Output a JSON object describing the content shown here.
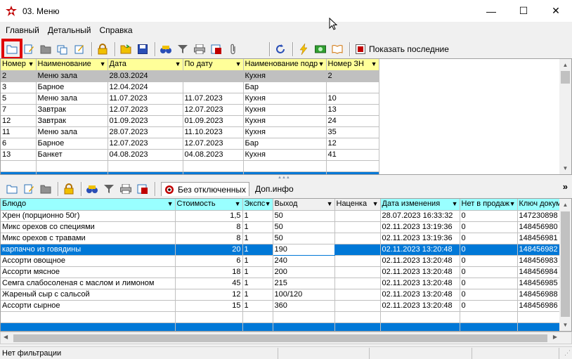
{
  "window": {
    "title": "03. Меню",
    "controls": {
      "minimize": "—",
      "maximize": "☐",
      "close": "✕"
    }
  },
  "menu": [
    "Главный",
    "Детальный",
    "Справка"
  ],
  "toolbar_top": {
    "show_last_label": "Показать последние"
  },
  "top_grid": {
    "columns": [
      "Номер",
      "Наименование",
      "Дата",
      "По дату",
      "Наименование подр",
      "Номер ЗН"
    ],
    "rows": [
      [
        "2",
        "Меню зала",
        "28.03.2024",
        "",
        "Кухня",
        "2"
      ],
      [
        "3",
        "Барное",
        "12.04.2024",
        "",
        "Бар",
        ""
      ],
      [
        "5",
        "Меню зала",
        "11.07.2023",
        "11.07.2023",
        "Кухня",
        "10"
      ],
      [
        "7",
        "Завтрак",
        "12.07.2023",
        "12.07.2023",
        "Кухня",
        "13"
      ],
      [
        "12",
        "Завтрак",
        "01.09.2023",
        "01.09.2023",
        "Кухня",
        "24"
      ],
      [
        "11",
        "Меню зала",
        "28.07.2023",
        "11.10.2023",
        "Кухня",
        "35"
      ],
      [
        "6",
        "Барное",
        "12.07.2023",
        "12.07.2023",
        "Бар",
        "12"
      ],
      [
        "13",
        "Банкет",
        "04.08.2023",
        "04.08.2023",
        "Кухня",
        "41"
      ]
    ]
  },
  "bottom_toolbar": {
    "tab_active": "Без отключенных",
    "tab_inactive": "Доп.инфо",
    "overflow": "»"
  },
  "bottom_grid": {
    "columns": [
      "Блюдо",
      "Стоимость",
      "Экспс",
      "Выход",
      "Наценка",
      "Дата изменения",
      "Нет в продаж",
      "Ключ докум"
    ],
    "rows": [
      [
        "Хрен (порционно 50г)",
        "1,5",
        "1",
        "50",
        "",
        "28.07.2023 16:33:32",
        "0",
        "147230898"
      ],
      [
        "Микс орехов со специями",
        "8",
        "1",
        "50",
        "",
        "02.11.2023 13:19:36",
        "0",
        "148456980"
      ],
      [
        "Микс орехов с травами",
        "8",
        "1",
        "50",
        "",
        "02.11.2023 13:19:36",
        "0",
        "148456981"
      ],
      [
        "карпаччо из говядины",
        "20",
        "1",
        "190",
        "",
        "02.11.2023 13:20:48",
        "0",
        "148456982"
      ],
      [
        "Ассорти овощное",
        "6",
        "1",
        "240",
        "",
        "02.11.2023 13:20:48",
        "0",
        "148456983"
      ],
      [
        "Ассорти мясное",
        "18",
        "1",
        "200",
        "",
        "02.11.2023 13:20:48",
        "0",
        "148456984"
      ],
      [
        "Семга слабосоленая с маслом и лимоном",
        "45",
        "1",
        "215",
        "",
        "02.11.2023 13:20:48",
        "0",
        "148456985"
      ],
      [
        "Жареный сыр с сальсой",
        "12",
        "1",
        "100/120",
        "",
        "02.11.2023 13:20:48",
        "0",
        "148456988"
      ],
      [
        "Ассорти сырное",
        "15",
        "1",
        "360",
        "",
        "02.11.2023 13:20:48",
        "0",
        "148456986"
      ]
    ]
  },
  "status": {
    "filter": "Нет фильтрации"
  }
}
